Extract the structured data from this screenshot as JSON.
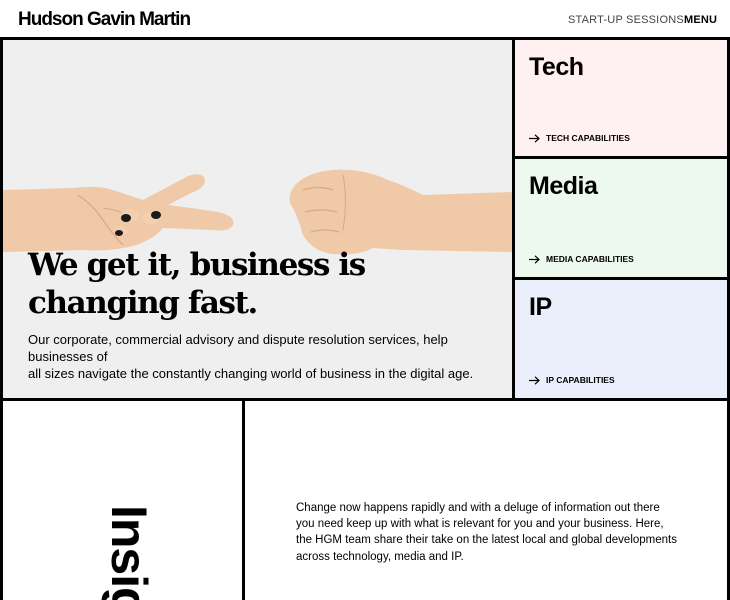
{
  "header": {
    "logo": "Hudson Gavin Martin",
    "nav": {
      "startup": "START-UP SESSIONS",
      "menu": "MENU"
    }
  },
  "hero": {
    "title": "We get it, business is changing fast.",
    "description_line1": "Our corporate, commercial advisory and dispute resolution services, help businesses of",
    "description_line2": "all sizes navigate the constantly changing world of business in the digital age."
  },
  "panels": {
    "tech": {
      "title": "Tech",
      "link": "TECH CAPABILITIES",
      "color": "#fff0f1"
    },
    "media": {
      "title": "Media",
      "link": "MEDIA CAPABILITIES",
      "color": "#edf8ef"
    },
    "ip": {
      "title": "IP",
      "link": "IP CAPABILITIES",
      "color": "#eaeffb"
    }
  },
  "insights": {
    "heading": "Insig",
    "text": "Change now happens rapidly and with a deluge of information out there you need keep up with what is relevant for you and your business. Here, the HGM team share their take on the latest local and global developments across technology, media and IP."
  },
  "icons": {
    "arrow": "arrow-right-icon",
    "hands": "hands-image"
  }
}
